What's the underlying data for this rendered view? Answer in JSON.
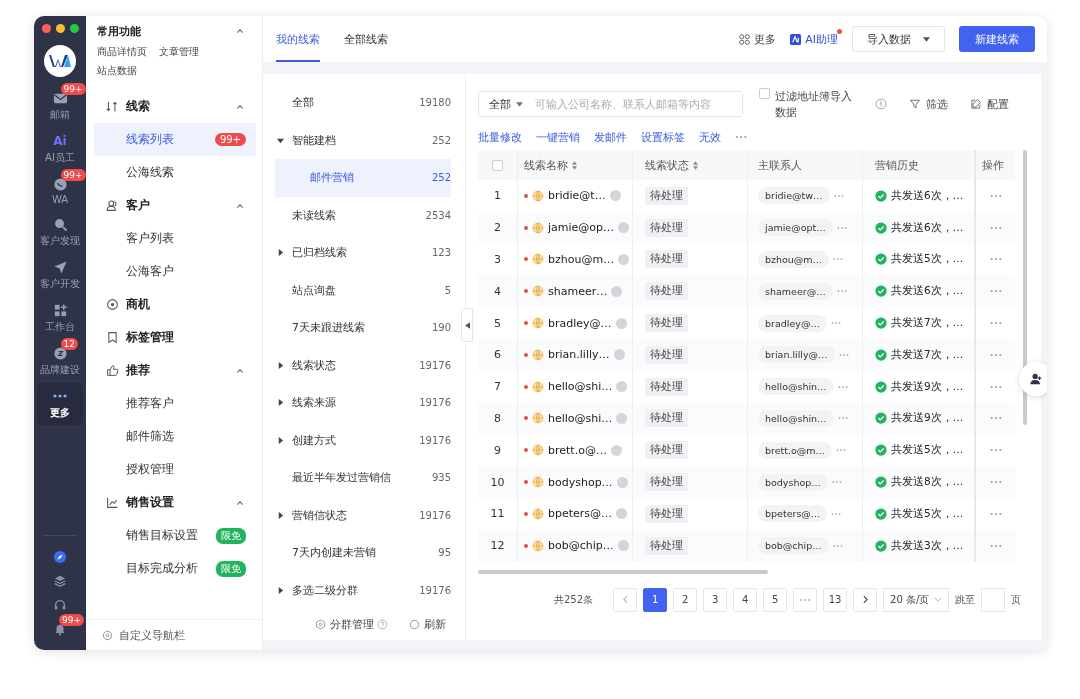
{
  "rail": {
    "items": [
      {
        "label": "邮箱",
        "badge": "99+",
        "selected": false
      },
      {
        "label": "AI员工",
        "glyph": "Ai",
        "selected": false
      },
      {
        "label": "WA",
        "badge": "99+",
        "selected": false
      },
      {
        "label": "客户发现",
        "selected": false
      },
      {
        "label": "客户开发",
        "selected": false
      },
      {
        "label": "工作台",
        "selected": false
      },
      {
        "label": "品牌建设",
        "badge": "12",
        "selected": false
      },
      {
        "label": "更多",
        "selected": true
      }
    ],
    "bell_badge": "99+"
  },
  "nav": {
    "sections": [
      {
        "kind": "quick",
        "title": "常用功能",
        "expanded": true,
        "children": [
          {
            "label": "商品详情页"
          },
          {
            "label": "文章管理"
          },
          {
            "label": "站点数据"
          }
        ]
      },
      {
        "kind": "group",
        "title": "线索",
        "expanded": true,
        "children": [
          {
            "label": "线索列表",
            "selected": true,
            "badge": {
              "text": "99+",
              "color": "#ee4d4d"
            }
          },
          {
            "label": "公海线索",
            "selected": false
          }
        ]
      },
      {
        "kind": "group",
        "title": "客户",
        "expanded": true,
        "children": [
          {
            "label": "客户列表",
            "selected": false
          },
          {
            "label": "公海客户",
            "selected": false
          }
        ]
      },
      {
        "kind": "single",
        "title": "商机"
      },
      {
        "kind": "single",
        "title": "标签管理"
      },
      {
        "kind": "group",
        "title": "推荐",
        "expanded": true,
        "children": [
          {
            "label": "推荐客户",
            "selected": false
          },
          {
            "label": "邮件筛选",
            "selected": false
          },
          {
            "label": "授权管理",
            "selected": false
          }
        ]
      },
      {
        "kind": "group",
        "title": "销售设置",
        "expanded": true,
        "children": [
          {
            "label": "销售目标设置",
            "selected": false,
            "badge": {
              "text": "限免",
              "color": "#22b35e"
            }
          },
          {
            "label": "目标完成分析",
            "selected": false,
            "badge": {
              "text": "限免",
              "color": "#22b35e"
            }
          }
        ]
      }
    ],
    "footer": "自定义导航栏"
  },
  "tabs": [
    {
      "label": "我的线索",
      "selected": true
    },
    {
      "label": "全部线索",
      "selected": false
    }
  ],
  "actions": {
    "more": "更多",
    "ai": "AI助理",
    "ai_dot": true,
    "import": "导入数据",
    "create": "新建线索"
  },
  "groups": {
    "items": [
      {
        "label": "全部",
        "count": "19180",
        "selected": false
      },
      {
        "label": "智能建档",
        "count": "252",
        "selected": false,
        "expanded": true,
        "children": [
          {
            "label": "邮件营销",
            "count": "252",
            "selected": true
          }
        ]
      },
      {
        "label": "未读线索",
        "count": "2534",
        "selected": false
      },
      {
        "label": "已归档线索",
        "count": "123",
        "selected": false,
        "expanded": false
      },
      {
        "label": "站点询盘",
        "count": "5",
        "selected": false
      },
      {
        "label": "7天未跟进线索",
        "count": "190",
        "selected": false
      },
      {
        "label": "线索状态",
        "count": "19176",
        "selected": false,
        "expanded": false
      },
      {
        "label": "线索来源",
        "count": "19176",
        "selected": false,
        "expanded": false
      },
      {
        "label": "创建方式",
        "count": "19176",
        "selected": false,
        "expanded": false
      },
      {
        "label": "最近半年发过营销信",
        "count": "935",
        "selected": false
      },
      {
        "label": "营销信状态",
        "count": "19176",
        "selected": false,
        "expanded": false
      },
      {
        "label": "7天内创建未营销",
        "count": "95",
        "selected": false
      },
      {
        "label": "多选二级分群",
        "count": "19176",
        "selected": false,
        "expanded": false
      }
    ],
    "manage": "分群管理",
    "refresh": "刷新"
  },
  "filter": {
    "scope": "全部",
    "placeholder": "可输入公司名称、联系人邮箱等内容",
    "option": {
      "label": "过滤地址簿导入数据",
      "checked": false
    },
    "filter": "筛选",
    "config": "配置"
  },
  "bulk_actions": [
    "批量修改",
    "一键营销",
    "发邮件",
    "设置标签",
    "无效"
  ],
  "table": {
    "select_all": false,
    "columns": [
      {
        "label": "线索名称",
        "sortable": true
      },
      {
        "label": "线索状态",
        "sortable": true
      },
      {
        "label": "主联系人",
        "sortable": false
      },
      {
        "label": "营销历史",
        "sortable": false
      },
      {
        "label": "操作",
        "sortable": false
      }
    ],
    "rows": [
      {
        "no": "1",
        "name": "bridie@t…",
        "status": "待处理",
        "contact": "bridie@tw…",
        "history": "共发送6次，…"
      },
      {
        "no": "2",
        "name": "jamie@op…",
        "status": "待处理",
        "contact": "jamie@opt…",
        "history": "共发送6次，…"
      },
      {
        "no": "3",
        "name": "bzhou@m…",
        "status": "待处理",
        "contact": "bzhou@m…",
        "history": "共发送5次，…"
      },
      {
        "no": "4",
        "name": "shameer…",
        "status": "待处理",
        "contact": "shameer@…",
        "history": "共发送6次，…"
      },
      {
        "no": "5",
        "name": "bradley@…",
        "status": "待处理",
        "contact": "bradley@…",
        "history": "共发送7次，…"
      },
      {
        "no": "6",
        "name": "brian.lilly…",
        "status": "待处理",
        "contact": "brian.lilly@…",
        "history": "共发送7次，…"
      },
      {
        "no": "7",
        "name": "hello@shi…",
        "status": "待处理",
        "contact": "hello@shin…",
        "history": "共发送9次，…"
      },
      {
        "no": "8",
        "name": "hello@shi…",
        "status": "待处理",
        "contact": "hello@shin…",
        "history": "共发送9次，…"
      },
      {
        "no": "9",
        "name": "brett.o@…",
        "status": "待处理",
        "contact": "brett.o@m…",
        "history": "共发送5次，…"
      },
      {
        "no": "10",
        "name": "bodyshop…",
        "status": "待处理",
        "contact": "bodyshop…",
        "history": "共发送8次，…"
      },
      {
        "no": "11",
        "name": "bpeters@…",
        "status": "待处理",
        "contact": "bpeters@…",
        "history": "共发送5次，…"
      },
      {
        "no": "12",
        "name": "bob@chip…",
        "status": "待处理",
        "contact": "bob@chip…",
        "history": "共发送3次，…"
      }
    ]
  },
  "pagination": {
    "total": "共252条",
    "pages": [
      {
        "kind": "page",
        "label": "1",
        "selected": true
      },
      {
        "kind": "page",
        "label": "2",
        "selected": false
      },
      {
        "kind": "page",
        "label": "3",
        "selected": false
      },
      {
        "kind": "page",
        "label": "4",
        "selected": false
      },
      {
        "kind": "page",
        "label": "5",
        "selected": false
      },
      {
        "kind": "gap"
      },
      {
        "kind": "page",
        "label": "13",
        "selected": false
      }
    ],
    "page_size": "20 条/页",
    "jump": "跳至",
    "jump_suffix": "页"
  }
}
